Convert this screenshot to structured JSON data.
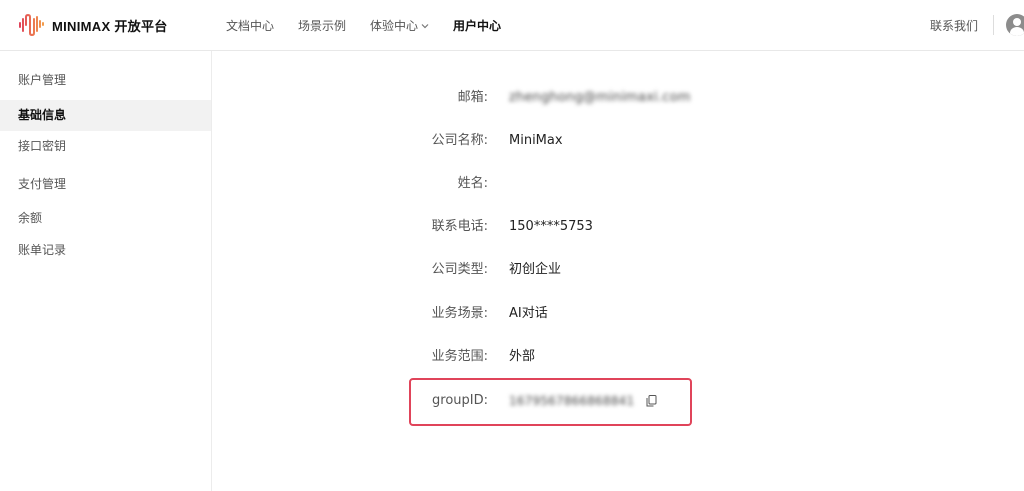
{
  "header": {
    "brand": "MINIMAX 开放平台",
    "nav": [
      {
        "label": "文档中心"
      },
      {
        "label": "场景示例"
      },
      {
        "label": "体验中心",
        "has_dropdown": true
      },
      {
        "label": "用户中心",
        "active": true
      }
    ],
    "contact": "联系我们"
  },
  "sidebar": {
    "items": [
      {
        "label": "账户管理"
      },
      {
        "label": "基础信息",
        "active": true
      },
      {
        "label": "接口密钥"
      },
      {
        "label": "支付管理"
      },
      {
        "label": "余额"
      },
      {
        "label": "账单记录"
      }
    ]
  },
  "profile": {
    "fields": [
      {
        "label": "邮箱:",
        "value": "zhenghong@minimaxi.com",
        "blurred": true
      },
      {
        "label": "公司名称:",
        "value": "MiniMax"
      },
      {
        "label": "姓名:",
        "value": ""
      },
      {
        "label": "联系电话:",
        "value": "150****5753"
      },
      {
        "label": "公司类型:",
        "value": "初创企业"
      },
      {
        "label": "业务场景:",
        "value": "AI对话"
      },
      {
        "label": "业务范围:",
        "value": "外部"
      },
      {
        "label": "groupID:",
        "value": "1679567866868841",
        "blurred": true
      }
    ]
  },
  "colors": {
    "highlight": "#e0445a",
    "brand_gradient_start": "#e0445a",
    "brand_gradient_end": "#f39c4b"
  },
  "icons": {
    "copy": "copy-icon",
    "avatar": "user-avatar-icon",
    "dropdown": "chevron-down-icon"
  }
}
